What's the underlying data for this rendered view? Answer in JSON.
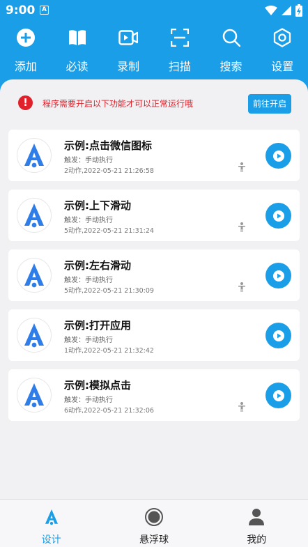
{
  "status_bar": {
    "time": "9:00",
    "notif_glyph": "A"
  },
  "toolbar": [
    {
      "label": "添加",
      "icon": "add-icon"
    },
    {
      "label": "必读",
      "icon": "book-icon"
    },
    {
      "label": "录制",
      "icon": "video-record-icon"
    },
    {
      "label": "扫描",
      "icon": "scan-icon"
    },
    {
      "label": "搜索",
      "icon": "search-icon"
    },
    {
      "label": "设置",
      "icon": "settings-icon"
    }
  ],
  "notice": {
    "icon_glyph": "!",
    "text": "程序需要开启以下功能才可以正常运行哦",
    "button": "前往开启"
  },
  "scripts": [
    {
      "title": "示例:点击微信图标",
      "trigger": "触发：手动执行",
      "meta": "2动作,2022-05-21 21:26:58"
    },
    {
      "title": "示例:上下滑动",
      "trigger": "触发：手动执行",
      "meta": "5动作,2022-05-21 21:31:24"
    },
    {
      "title": "示例:左右滑动",
      "trigger": "触发：手动执行",
      "meta": "5动作,2022-05-21 21:30:09"
    },
    {
      "title": "示例:打开应用",
      "trigger": "触发：手动执行",
      "meta": "1动作,2022-05-21 21:32:42"
    },
    {
      "title": "示例:模拟点击",
      "trigger": "触发：手动执行",
      "meta": "6动作,2022-05-21 21:32:06"
    }
  ],
  "bottom_nav": [
    {
      "label": "设计",
      "icon": "design-icon",
      "active": true
    },
    {
      "label": "悬浮球",
      "icon": "floating-ball-icon",
      "active": false
    },
    {
      "label": "我的",
      "icon": "profile-icon",
      "active": false
    }
  ],
  "colors": {
    "primary": "#1a9ee8",
    "warning": "#e0202a"
  }
}
